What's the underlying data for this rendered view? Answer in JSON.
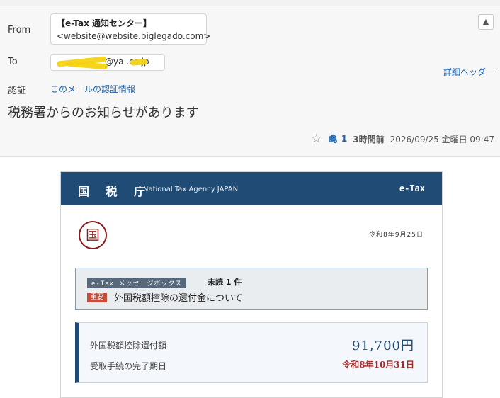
{
  "header": {
    "from_label": "From",
    "from_name": "【e-Tax 通知センター】",
    "from_addr": "<website@website.biglegado.com>",
    "to_label": "To",
    "to_addr": "@ya    .co.jp",
    "auth_label": "認証",
    "auth_link": "このメールの認証情報",
    "detail_link": "詳細ヘッダー",
    "subject": "税務署からのお知らせがあります",
    "attachment_count": "1",
    "relative_time": "3時間前",
    "datetime": "2026/09/25 金曜日 09:47"
  },
  "email": {
    "agency": "国 税 庁",
    "agency_en": "National Tax Agency JAPAN",
    "brand": "e-Tax",
    "seal_char": "国",
    "date": "令和8年9月25日",
    "message_box": {
      "tag": "e-Tax メッセージボックス",
      "unread": "未読 1 件",
      "important": "重要",
      "title": "外国税額控除の還付金について"
    },
    "refund": {
      "amount_label": "外国税額控除還付額",
      "amount": "91,700円",
      "deadline_label": "受取手続の完了期日",
      "deadline": "令和8年10月31日"
    }
  },
  "colors": {
    "banner": "#1f4b74",
    "link": "#1a62b0",
    "seal": "#8b1a1a",
    "deadline": "#a52a2a",
    "scribble": "#f5d312"
  },
  "icons": {
    "star": "star-icon",
    "attachment": "paperclip-icon",
    "collapse": "chevron-up-icon"
  }
}
